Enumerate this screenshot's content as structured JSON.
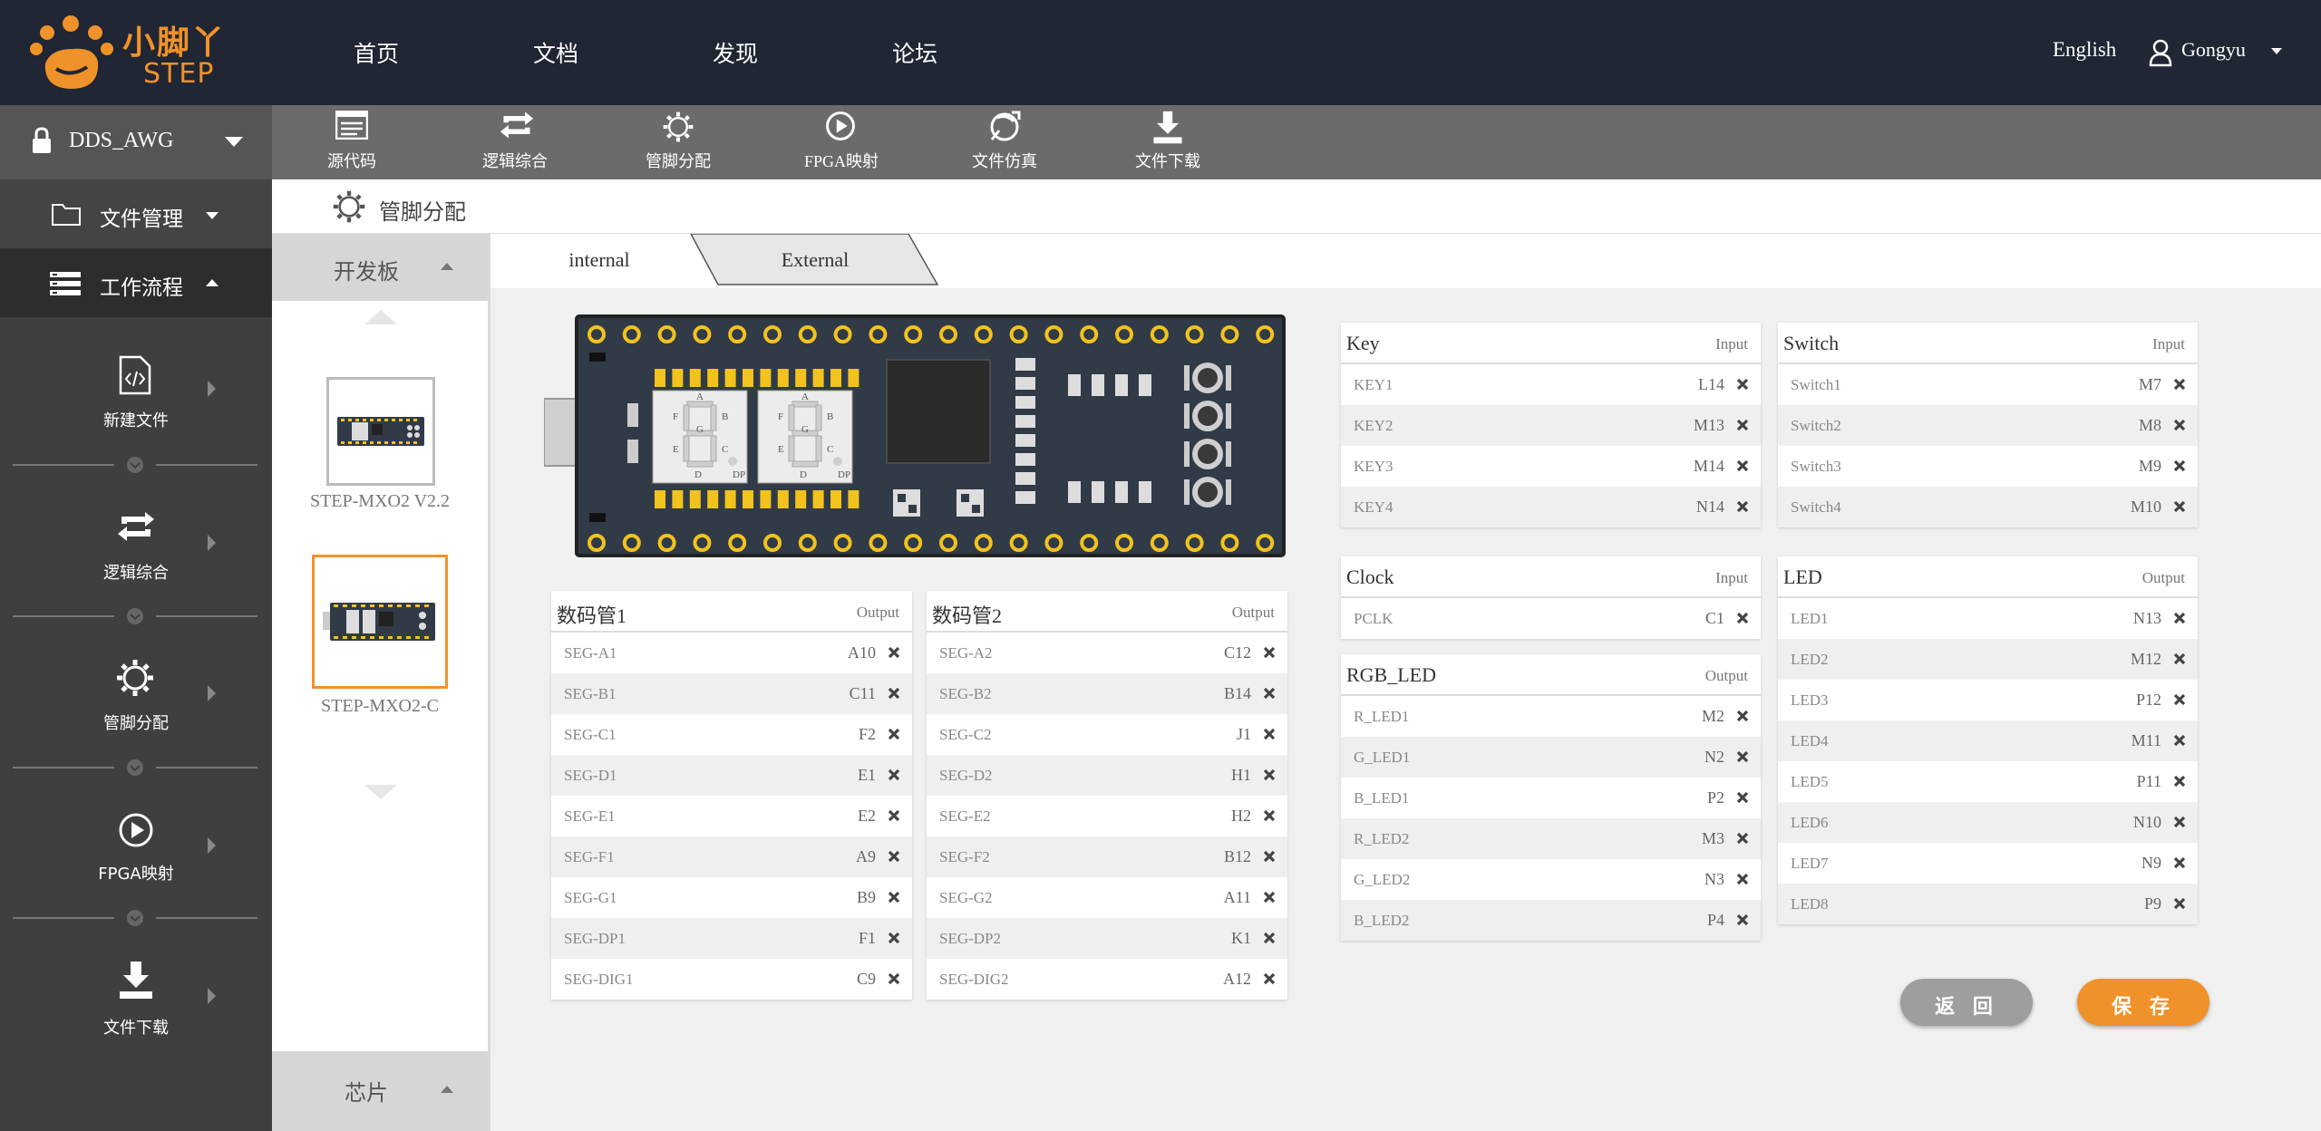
{
  "brand": {
    "name": "小脚丫",
    "sub": "STEP"
  },
  "topnav": {
    "items": [
      "首页",
      "文档",
      "发现",
      "论坛"
    ],
    "language": "English",
    "user": "Gongyu"
  },
  "project": {
    "name": "DDS_AWG"
  },
  "sidebar": {
    "file_manage": "文件管理",
    "workflow": "工作流程",
    "steps": [
      "新建文件",
      "逻辑综合",
      "管脚分配",
      "FPGA映射",
      "文件下载"
    ]
  },
  "toolbar": {
    "items": [
      "源代码",
      "逻辑综合",
      "管脚分配",
      "FPGA映射",
      "文件仿真",
      "文件下载"
    ]
  },
  "section": {
    "title": "管脚分配"
  },
  "board_panel": {
    "header": "开发板",
    "footer": "芯片",
    "boards": [
      "STEP-MXO2 V2.2",
      "STEP-MXO2-C"
    ],
    "selected": "STEP-MXO2-C"
  },
  "tabs": {
    "internal": "internal",
    "external": "External",
    "active": "internal"
  },
  "boxes": {
    "seg1": {
      "title": "数码管1",
      "dir": "Output",
      "rows": [
        {
          "name": "SEG-A1",
          "pin": "A10"
        },
        {
          "name": "SEG-B1",
          "pin": "C11"
        },
        {
          "name": "SEG-C1",
          "pin": "F2"
        },
        {
          "name": "SEG-D1",
          "pin": "E1"
        },
        {
          "name": "SEG-E1",
          "pin": "E2"
        },
        {
          "name": "SEG-F1",
          "pin": "A9"
        },
        {
          "name": "SEG-G1",
          "pin": "B9"
        },
        {
          "name": "SEG-DP1",
          "pin": "F1"
        },
        {
          "name": "SEG-DIG1",
          "pin": "C9"
        }
      ]
    },
    "seg2": {
      "title": "数码管2",
      "dir": "Output",
      "rows": [
        {
          "name": "SEG-A2",
          "pin": "C12"
        },
        {
          "name": "SEG-B2",
          "pin": "B14"
        },
        {
          "name": "SEG-C2",
          "pin": "J1"
        },
        {
          "name": "SEG-D2",
          "pin": "H1"
        },
        {
          "name": "SEG-E2",
          "pin": "H2"
        },
        {
          "name": "SEG-F2",
          "pin": "B12"
        },
        {
          "name": "SEG-G2",
          "pin": "A11"
        },
        {
          "name": "SEG-DP2",
          "pin": "K1"
        },
        {
          "name": "SEG-DIG2",
          "pin": "A12"
        }
      ]
    },
    "key": {
      "title": "Key",
      "dir": "Input",
      "rows": [
        {
          "name": "KEY1",
          "pin": "L14"
        },
        {
          "name": "KEY2",
          "pin": "M13"
        },
        {
          "name": "KEY3",
          "pin": "M14"
        },
        {
          "name": "KEY4",
          "pin": "N14"
        }
      ]
    },
    "switch": {
      "title": "Switch",
      "dir": "Input",
      "rows": [
        {
          "name": "Switch1",
          "pin": "M7"
        },
        {
          "name": "Switch2",
          "pin": "M8"
        },
        {
          "name": "Switch3",
          "pin": "M9"
        },
        {
          "name": "Switch4",
          "pin": "M10"
        }
      ]
    },
    "clock": {
      "title": "Clock",
      "dir": "Input",
      "rows": [
        {
          "name": "PCLK",
          "pin": "C1"
        }
      ]
    },
    "rgb": {
      "title": "RGB_LED",
      "dir": "Output",
      "rows": [
        {
          "name": "R_LED1",
          "pin": "M2"
        },
        {
          "name": "G_LED1",
          "pin": "N2"
        },
        {
          "name": "B_LED1",
          "pin": "P2"
        },
        {
          "name": "R_LED2",
          "pin": "M3"
        },
        {
          "name": "G_LED2",
          "pin": "N3"
        },
        {
          "name": "B_LED2",
          "pin": "P4"
        }
      ]
    },
    "led": {
      "title": "LED",
      "dir": "Output",
      "rows": [
        {
          "name": "LED1",
          "pin": "N13"
        },
        {
          "name": "LED2",
          "pin": "M12"
        },
        {
          "name": "LED3",
          "pin": "P12"
        },
        {
          "name": "LED4",
          "pin": "M11"
        },
        {
          "name": "LED5",
          "pin": "P11"
        },
        {
          "name": "LED6",
          "pin": "N10"
        },
        {
          "name": "LED7",
          "pin": "N9"
        },
        {
          "name": "LED8",
          "pin": "P9"
        }
      ]
    }
  },
  "seg_digit_letters": [
    "A",
    "B",
    "C",
    "D",
    "E",
    "F",
    "G",
    "DP"
  ],
  "buttons": {
    "back": "返 回",
    "save": "保 存"
  },
  "colors": {
    "topbar": "#202633",
    "accent": "#f0922a",
    "sidebar": "#3f3f3f",
    "toolbar": "#6b6b6b",
    "board": "#313b47",
    "pad": "#f2c31f",
    "back": "#9e9e9e"
  }
}
